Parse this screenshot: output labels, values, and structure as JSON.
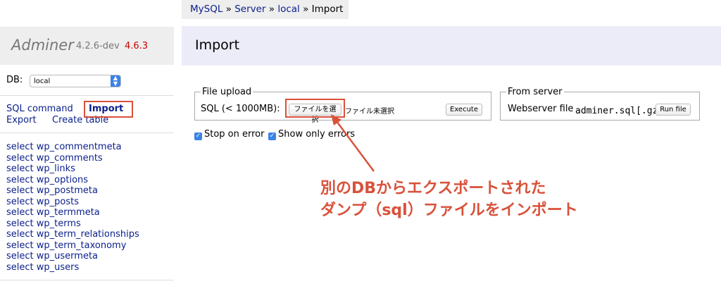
{
  "breadcrumb": {
    "mysql": "MySQL",
    "sep1": " » ",
    "server": "Server",
    "sep2": " » ",
    "local": "local",
    "sep3": " » ",
    "current": "Import"
  },
  "logo": {
    "name": "Adminer",
    "version": "4.2.6-dev",
    "new_version": "4.6.3"
  },
  "db": {
    "label": "DB:",
    "selected": "local"
  },
  "menu": {
    "sql_command": "SQL command",
    "import": "Import",
    "export": "Export",
    "create_table": "Create table"
  },
  "tables": [
    {
      "select": "select",
      "name": "wp_commentmeta"
    },
    {
      "select": "select",
      "name": "wp_comments"
    },
    {
      "select": "select",
      "name": "wp_links"
    },
    {
      "select": "select",
      "name": "wp_options"
    },
    {
      "select": "select",
      "name": "wp_postmeta"
    },
    {
      "select": "select",
      "name": "wp_posts"
    },
    {
      "select": "select",
      "name": "wp_termmeta"
    },
    {
      "select": "select",
      "name": "wp_terms"
    },
    {
      "select": "select",
      "name": "wp_term_relationships"
    },
    {
      "select": "select",
      "name": "wp_term_taxonomy"
    },
    {
      "select": "select",
      "name": "wp_usermeta"
    },
    {
      "select": "select",
      "name": "wp_users"
    }
  ],
  "page_title": "Import",
  "file_upload": {
    "legend": "File upload",
    "label": "SQL (< 1000MB):",
    "choose_file": "ファイルを選択",
    "no_file": "ファイル未選択",
    "execute": "Execute"
  },
  "from_server": {
    "legend": "From server",
    "label": "Webserver file",
    "file": "adminer.sql[.gz]",
    "run_file": "Run file"
  },
  "options": {
    "stop_on_error": "Stop on error",
    "show_only_errors": "Show only errors"
  },
  "annotation": {
    "line1": "別のDBからエクスポートされた",
    "line2": "ダンプ（sql）ファイルをインポート"
  },
  "colors": {
    "accent": "#d9513a",
    "link": "#0a1e8c",
    "checkbox": "#3b82e6"
  }
}
